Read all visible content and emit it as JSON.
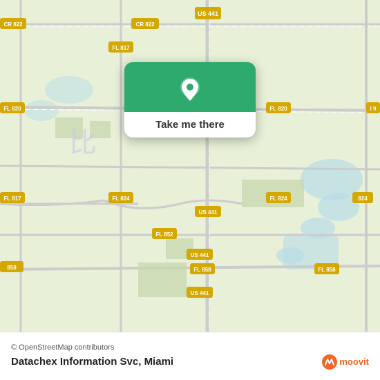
{
  "map": {
    "attribution": "© OpenStreetMap contributors",
    "background_color": "#e8f0d8"
  },
  "popup": {
    "button_label": "Take me there",
    "pin_color": "#ffffff"
  },
  "bottom_bar": {
    "location_name": "Datachex Information Svc,",
    "city": "Miami",
    "attribution": "© OpenStreetMap contributors"
  },
  "moovit": {
    "logo_text": "moovit",
    "icon_letter": "m"
  },
  "road_labels": {
    "us441_top": "US 441",
    "us441_mid": "US 441",
    "us441_bot1": "US 441",
    "us441_bot2": "US 441",
    "fl817_top": "FL 817",
    "fl817_bot": "FL 817",
    "fl820": "FL 820",
    "fl820_right": "FL 820",
    "fl824": "FL 824",
    "fl824_right": "FL 824",
    "fl852": "FL 852",
    "fl858": "FL 858",
    "fl858_right": "FL 858",
    "cr822_left": "CR 822",
    "cr822_top": "CR 822",
    "cr858": "858",
    "i9": "I 9"
  }
}
